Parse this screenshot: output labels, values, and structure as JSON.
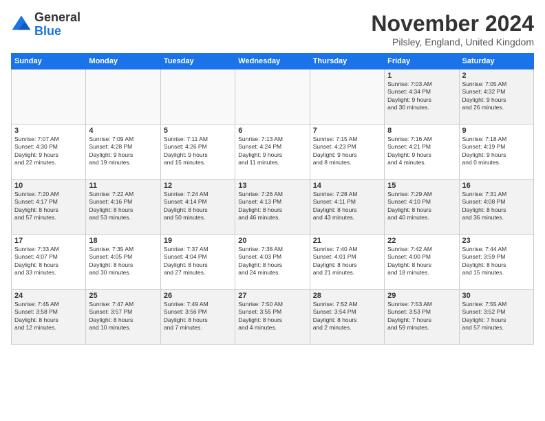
{
  "logo": {
    "general": "General",
    "blue": "Blue"
  },
  "header": {
    "month": "November 2024",
    "location": "Pilsley, England, United Kingdom"
  },
  "weekdays": [
    "Sunday",
    "Monday",
    "Tuesday",
    "Wednesday",
    "Thursday",
    "Friday",
    "Saturday"
  ],
  "weeks": [
    [
      {
        "day": "",
        "info": ""
      },
      {
        "day": "",
        "info": ""
      },
      {
        "day": "",
        "info": ""
      },
      {
        "day": "",
        "info": ""
      },
      {
        "day": "",
        "info": ""
      },
      {
        "day": "1",
        "info": "Sunrise: 7:03 AM\nSunset: 4:34 PM\nDaylight: 9 hours\nand 30 minutes."
      },
      {
        "day": "2",
        "info": "Sunrise: 7:05 AM\nSunset: 4:32 PM\nDaylight: 9 hours\nand 26 minutes."
      }
    ],
    [
      {
        "day": "3",
        "info": "Sunrise: 7:07 AM\nSunset: 4:30 PM\nDaylight: 9 hours\nand 22 minutes."
      },
      {
        "day": "4",
        "info": "Sunrise: 7:09 AM\nSunset: 4:28 PM\nDaylight: 9 hours\nand 19 minutes."
      },
      {
        "day": "5",
        "info": "Sunrise: 7:11 AM\nSunset: 4:26 PM\nDaylight: 9 hours\nand 15 minutes."
      },
      {
        "day": "6",
        "info": "Sunrise: 7:13 AM\nSunset: 4:24 PM\nDaylight: 9 hours\nand 11 minutes."
      },
      {
        "day": "7",
        "info": "Sunrise: 7:15 AM\nSunset: 4:23 PM\nDaylight: 9 hours\nand 8 minutes."
      },
      {
        "day": "8",
        "info": "Sunrise: 7:16 AM\nSunset: 4:21 PM\nDaylight: 9 hours\nand 4 minutes."
      },
      {
        "day": "9",
        "info": "Sunrise: 7:18 AM\nSunset: 4:19 PM\nDaylight: 9 hours\nand 0 minutes."
      }
    ],
    [
      {
        "day": "10",
        "info": "Sunrise: 7:20 AM\nSunset: 4:17 PM\nDaylight: 8 hours\nand 57 minutes."
      },
      {
        "day": "11",
        "info": "Sunrise: 7:22 AM\nSunset: 4:16 PM\nDaylight: 8 hours\nand 53 minutes."
      },
      {
        "day": "12",
        "info": "Sunrise: 7:24 AM\nSunset: 4:14 PM\nDaylight: 8 hours\nand 50 minutes."
      },
      {
        "day": "13",
        "info": "Sunrise: 7:26 AM\nSunset: 4:13 PM\nDaylight: 8 hours\nand 46 minutes."
      },
      {
        "day": "14",
        "info": "Sunrise: 7:28 AM\nSunset: 4:11 PM\nDaylight: 8 hours\nand 43 minutes."
      },
      {
        "day": "15",
        "info": "Sunrise: 7:29 AM\nSunset: 4:10 PM\nDaylight: 8 hours\nand 40 minutes."
      },
      {
        "day": "16",
        "info": "Sunrise: 7:31 AM\nSunset: 4:08 PM\nDaylight: 8 hours\nand 36 minutes."
      }
    ],
    [
      {
        "day": "17",
        "info": "Sunrise: 7:33 AM\nSunset: 4:07 PM\nDaylight: 8 hours\nand 33 minutes."
      },
      {
        "day": "18",
        "info": "Sunrise: 7:35 AM\nSunset: 4:05 PM\nDaylight: 8 hours\nand 30 minutes."
      },
      {
        "day": "19",
        "info": "Sunrise: 7:37 AM\nSunset: 4:04 PM\nDaylight: 8 hours\nand 27 minutes."
      },
      {
        "day": "20",
        "info": "Sunrise: 7:38 AM\nSunset: 4:03 PM\nDaylight: 8 hours\nand 24 minutes."
      },
      {
        "day": "21",
        "info": "Sunrise: 7:40 AM\nSunset: 4:01 PM\nDaylight: 8 hours\nand 21 minutes."
      },
      {
        "day": "22",
        "info": "Sunrise: 7:42 AM\nSunset: 4:00 PM\nDaylight: 8 hours\nand 18 minutes."
      },
      {
        "day": "23",
        "info": "Sunrise: 7:44 AM\nSunset: 3:59 PM\nDaylight: 8 hours\nand 15 minutes."
      }
    ],
    [
      {
        "day": "24",
        "info": "Sunrise: 7:45 AM\nSunset: 3:58 PM\nDaylight: 8 hours\nand 12 minutes."
      },
      {
        "day": "25",
        "info": "Sunrise: 7:47 AM\nSunset: 3:57 PM\nDaylight: 8 hours\nand 10 minutes."
      },
      {
        "day": "26",
        "info": "Sunrise: 7:49 AM\nSunset: 3:56 PM\nDaylight: 8 hours\nand 7 minutes."
      },
      {
        "day": "27",
        "info": "Sunrise: 7:50 AM\nSunset: 3:55 PM\nDaylight: 8 hours\nand 4 minutes."
      },
      {
        "day": "28",
        "info": "Sunrise: 7:52 AM\nSunset: 3:54 PM\nDaylight: 8 hours\nand 2 minutes."
      },
      {
        "day": "29",
        "info": "Sunrise: 7:53 AM\nSunset: 3:53 PM\nDaylight: 7 hours\nand 59 minutes."
      },
      {
        "day": "30",
        "info": "Sunrise: 7:55 AM\nSunset: 3:52 PM\nDaylight: 7 hours\nand 57 minutes."
      }
    ]
  ]
}
